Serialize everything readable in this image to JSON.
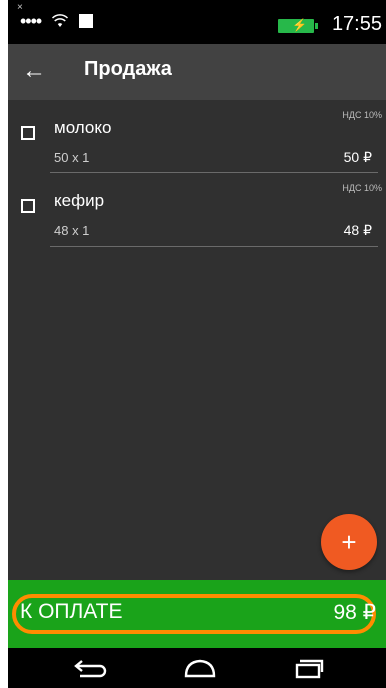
{
  "status_bar": {
    "time": "17:55",
    "close_mark": "×",
    "signal_dots": "••••",
    "battery_bolt": "⚡"
  },
  "toolbar": {
    "back_icon": "←",
    "title": "Продажа"
  },
  "items": [
    {
      "name": "молоко",
      "qty": "50 x 1",
      "vat": "НДС 10%",
      "price": "50 ₽",
      "checked": false
    },
    {
      "name": "кефир",
      "qty": "48 x 1",
      "vat": "НДС 10%",
      "price": "48 ₽",
      "checked": false
    }
  ],
  "fab": {
    "label": "+"
  },
  "payment": {
    "label": "К ОПЛАТЕ",
    "amount": "98 ₽"
  },
  "colors": {
    "toolbar": "#424242",
    "content": "#303030",
    "accent_fab": "#f05a22",
    "pay_bar": "#1aa31a",
    "highlight": "#ff8c00"
  },
  "icons": {
    "back": "arrow-left-icon",
    "wifi": "wifi-icon",
    "battery": "battery-icon",
    "nav_back": "nav-back-icon",
    "nav_home": "nav-home-icon",
    "nav_recent": "nav-recent-icon"
  }
}
